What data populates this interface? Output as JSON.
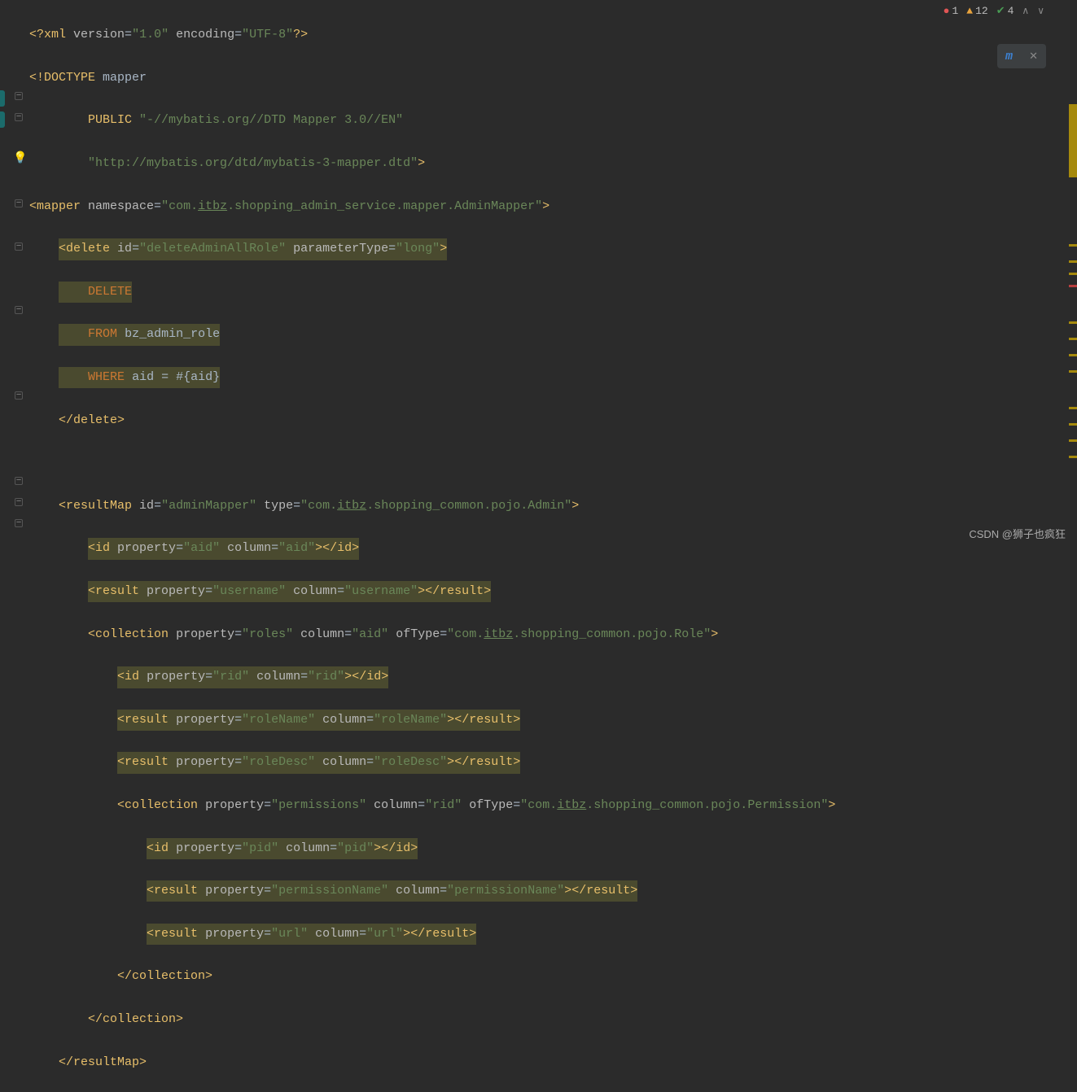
{
  "inspections": {
    "errors": "1",
    "warnings": "12",
    "ok": "4"
  },
  "watermark": "CSDN @狮子也疯狂",
  "code": {
    "l1": {
      "xml": "<?xml",
      "version_a": "version",
      "version_v": "\"1.0\"",
      "encoding_a": "encoding",
      "encoding_v": "\"UTF-8\"",
      "close": "?>"
    },
    "l2": {
      "doctype": "<!DOCTYPE",
      "mapper": "mapper"
    },
    "l3": {
      "public": "PUBLIC",
      "val": "\"-//mybatis.org//DTD Mapper 3.0//EN\""
    },
    "l4": {
      "url": "\"http://mybatis.org/dtd/mybatis-3-mapper.dtd\"",
      "gt": ">"
    },
    "l5": {
      "open": "<mapper",
      "ns_a": "namespace",
      "ns_v1": "\"com.",
      "ns_itbz": "itbz",
      "ns_v2": ".shopping_admin_service.mapper.AdminMapper\"",
      "gt": ">"
    },
    "l6": {
      "open": "<delete",
      "id_a": "id",
      "id_v": "\"deleteAdminAllRole\"",
      "pt_a": "parameterType",
      "pt_v": "\"long\"",
      "gt": ">"
    },
    "l7": {
      "kw": "DELETE"
    },
    "l8": {
      "kw": "FROM",
      "tbl": "bz_admin_role"
    },
    "l9": {
      "kw": "WHERE",
      "rest": "aid = #{aid}"
    },
    "l10": {
      "close": "</delete>"
    },
    "l12": {
      "open": "<resultMap",
      "id_a": "id",
      "id_v": "\"adminMapper\"",
      "type_a": "type",
      "type_v1": "\"com.",
      "type_itbz": "itbz",
      "type_v2": ".shopping_common.pojo.Admin\"",
      "gt": ">"
    },
    "l13": {
      "open": "<id",
      "prop_a": "property",
      "prop_v": "\"aid\"",
      "col_a": "column",
      "col_v": "\"aid\"",
      "gt": ">",
      "close": "</id>"
    },
    "l14": {
      "open": "<result",
      "prop_a": "property",
      "prop_v": "\"username\"",
      "col_a": "column",
      "col_v": "\"username\"",
      "gt": ">",
      "close": "</result>"
    },
    "l15": {
      "open": "<collection",
      "prop_a": "property",
      "prop_v": "\"roles\"",
      "col_a": "column",
      "col_v": "\"aid\"",
      "of_a": "ofType",
      "of_v1": "\"com.",
      "of_itbz": "itbz",
      "of_v2": ".shopping_common.pojo.Role\"",
      "gt": ">"
    },
    "l16": {
      "open": "<id",
      "prop_a": "property",
      "prop_v": "\"rid\"",
      "col_a": "column",
      "col_v": "\"rid\"",
      "gt": ">",
      "close": "</id>"
    },
    "l17": {
      "open": "<result",
      "prop_a": "property",
      "prop_v": "\"roleName\"",
      "col_a": "column",
      "col_v": "\"roleName\"",
      "gt": ">",
      "close": "</result>"
    },
    "l18": {
      "open": "<result",
      "prop_a": "property",
      "prop_v": "\"roleDesc\"",
      "col_a": "column",
      "col_v": "\"roleDesc\"",
      "gt": ">",
      "close": "</result>"
    },
    "l19": {
      "open": "<collection",
      "prop_a": "property",
      "prop_v": "\"permissions\"",
      "col_a": "column",
      "col_v": "\"rid\"",
      "of_a": "ofType",
      "of_v1": "\"com.",
      "of_itbz": "itbz",
      "of_v2": ".shopping_common.pojo.Permission\"",
      "gt": ">"
    },
    "l20": {
      "open": "<id",
      "prop_a": "property",
      "prop_v": "\"pid\"",
      "col_a": "column",
      "col_v": "\"pid\"",
      "gt": ">",
      "close": "</id>"
    },
    "l21": {
      "open": "<result",
      "prop_a": "property",
      "prop_v": "\"permissionName\"",
      "col_a": "column",
      "col_v": "\"permissionName\"",
      "gt": ">",
      "close": "</result>"
    },
    "l22": {
      "open": "<result",
      "prop_a": "property",
      "prop_v": "\"url\"",
      "col_a": "column",
      "col_v": "\"url\"",
      "gt": ">",
      "close": "</result>"
    },
    "l23": {
      "close": "</collection>"
    },
    "l24": {
      "close": "</collection>"
    },
    "l25": {
      "close": "</resultMap>"
    }
  }
}
